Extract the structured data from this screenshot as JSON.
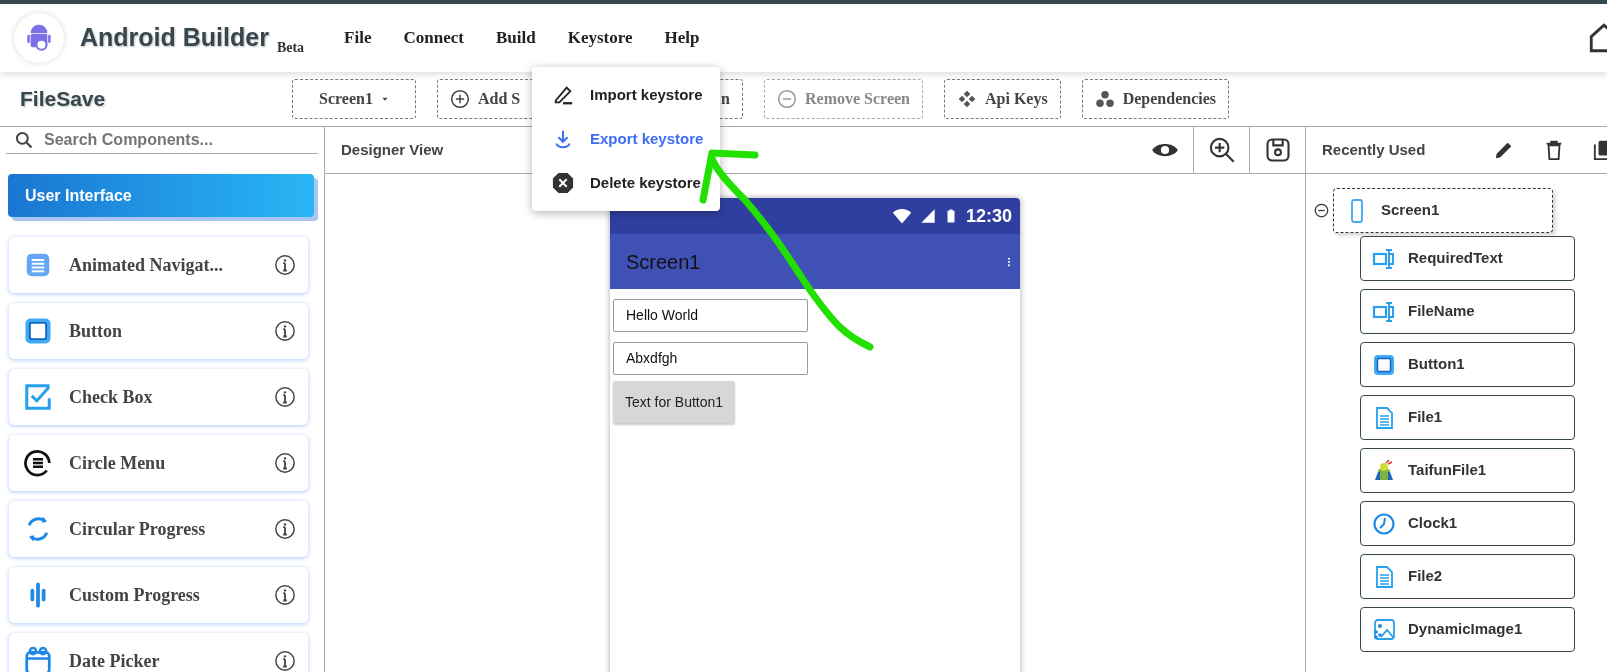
{
  "app": {
    "title": "Android Builder",
    "badge": "Beta"
  },
  "menu": [
    {
      "label": "File"
    },
    {
      "label": "Connect"
    },
    {
      "label": "Build"
    },
    {
      "label": "Keystore"
    },
    {
      "label": "Help"
    }
  ],
  "keystore_menu": [
    {
      "label": "Import keystore",
      "kind": "import",
      "selected": false
    },
    {
      "label": "Export keystore",
      "kind": "export",
      "selected": true
    },
    {
      "label": "Delete keystore",
      "kind": "delete",
      "selected": false
    }
  ],
  "project": "FileSave",
  "toolbar": [
    {
      "kind": "dropdown",
      "label": "Screen1",
      "disabled": false
    },
    {
      "kind": "add",
      "label": "Add S",
      "label_end": "n",
      "disabled": false
    },
    {
      "kind": "remove",
      "label": "Remove Screen",
      "disabled": true
    },
    {
      "kind": "keys",
      "label": "Api Keys",
      "disabled": false
    },
    {
      "kind": "deps",
      "label": "Dependencies",
      "disabled": false
    }
  ],
  "palette": {
    "placeholder": "Search Components...",
    "category": "User Interface",
    "items": [
      {
        "label": "Animated Navigat...",
        "kind": "nav"
      },
      {
        "label": "Button",
        "kind": "button"
      },
      {
        "label": "Check Box",
        "kind": "checkbox"
      },
      {
        "label": "Circle Menu",
        "kind": "circlemenu"
      },
      {
        "label": "Circular Progress",
        "kind": "circular"
      },
      {
        "label": "Custom Progress",
        "kind": "custom"
      },
      {
        "label": "Date Picker",
        "kind": "date"
      }
    ]
  },
  "designer": {
    "title": "Designer View"
  },
  "phone": {
    "time": "12:30",
    "title": "Screen1",
    "components": [
      {
        "kind": "textbox",
        "text": "Hello World"
      },
      {
        "kind": "textbox",
        "text": "Abxdfgh"
      },
      {
        "kind": "button",
        "text": "Text for Button1"
      }
    ]
  },
  "tree": {
    "title": "Recently Used",
    "root": {
      "label": "Screen1",
      "expanded": true,
      "children": [
        {
          "label": "RequiredText",
          "kind": "textbox"
        },
        {
          "label": "FileName",
          "kind": "textbox"
        },
        {
          "label": "Button1",
          "kind": "button"
        },
        {
          "label": "File1",
          "kind": "file"
        },
        {
          "label": "TaifunFile1",
          "kind": "extension"
        },
        {
          "label": "Clock1",
          "kind": "clock"
        },
        {
          "label": "File2",
          "kind": "file"
        },
        {
          "label": "DynamicImage1",
          "kind": "image"
        }
      ]
    }
  }
}
